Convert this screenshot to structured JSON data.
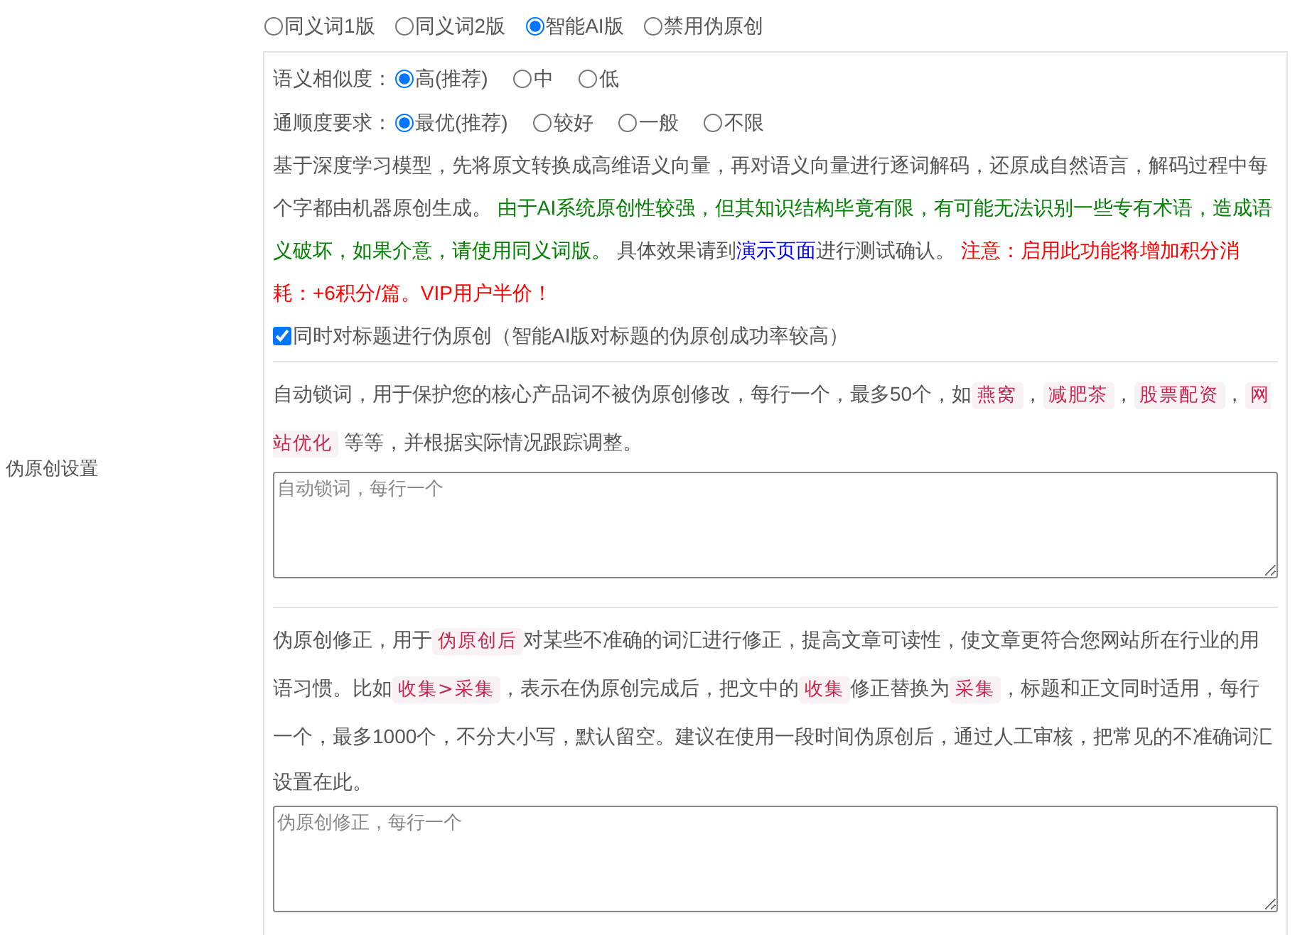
{
  "section_label": "伪原创设置",
  "modes": [
    {
      "label": "同义词1版",
      "selected": false
    },
    {
      "label": "同义词2版",
      "selected": false
    },
    {
      "label": "智能AI版",
      "selected": true
    },
    {
      "label": "禁用伪原创",
      "selected": false
    }
  ],
  "similarity": {
    "label": "语义相似度：",
    "options": [
      {
        "label": "高(推荐)",
        "selected": true
      },
      {
        "label": "中",
        "selected": false
      },
      {
        "label": "低",
        "selected": false
      }
    ]
  },
  "fluency": {
    "label": "通顺度要求：",
    "options": [
      {
        "label": "最优(推荐)",
        "selected": true
      },
      {
        "label": "较好",
        "selected": false
      },
      {
        "label": "一般",
        "selected": false
      },
      {
        "label": "不限",
        "selected": false
      }
    ]
  },
  "ai_description": [
    {
      "kind": "plain",
      "text": "基于深度学习模型，先将原文转换成高维语义向量，再对语义向量进行逐词解码，还原成自然语言，解码过程中每个字都由机器原创生成。 "
    },
    {
      "kind": "green",
      "text": "由于AI系统原创性较强，但其知识结构毕竟有限，有可能无法识别一些专有术语，造成语义破坏，如果介意，请使用同义词版。"
    },
    {
      "kind": "plain",
      "text": " 具体效果请到"
    },
    {
      "kind": "link",
      "text": "演示页面"
    },
    {
      "kind": "plain",
      "text": "进行测试确认。 "
    },
    {
      "kind": "red",
      "text": "注意：启用此功能将增加积分消耗：+6积分/篇。VIP用户半价！"
    }
  ],
  "title_option": {
    "label": "同时对标题进行伪原创（智能AI版对标题的伪原创成功率较高）",
    "checked": true
  },
  "lock_words": {
    "description": [
      {
        "kind": "plain",
        "text": "自动锁词，用于保护您的核心产品词不被伪原创修改，每行一个，最多50个，如"
      },
      {
        "kind": "code",
        "text": "燕窝"
      },
      {
        "kind": "plain",
        "text": "，"
      },
      {
        "kind": "code",
        "text": "减肥茶"
      },
      {
        "kind": "plain",
        "text": "，"
      },
      {
        "kind": "code",
        "text": "股票配资"
      },
      {
        "kind": "plain",
        "text": "，"
      },
      {
        "kind": "code",
        "text": "网站优化"
      },
      {
        "kind": "plain",
        "text": " 等等，并根据实际情况跟踪调整。"
      }
    ],
    "placeholder": "自动锁词，每行一个"
  },
  "corrections": {
    "description": [
      {
        "kind": "plain",
        "text": "伪原创修正，用于"
      },
      {
        "kind": "code",
        "text": "伪原创后"
      },
      {
        "kind": "plain",
        "text": "对某些不准确的词汇进行修正，提高文章可读性，使文章更符合您网站所在行业的用语习惯。比如"
      },
      {
        "kind": "code",
        "text": "收集>采集"
      },
      {
        "kind": "plain",
        "text": "，表示在伪原创完成后，把文中的"
      },
      {
        "kind": "code",
        "text": "收集"
      },
      {
        "kind": "plain",
        "text": "修正替换为"
      },
      {
        "kind": "code",
        "text": "采集"
      },
      {
        "kind": "plain",
        "text": "，标题和正文同时适用，每行一个，最多1000个，不分大小写，默认留空。建议在使用一段时间伪原创后，通过人工审核，把常见的不准确词汇设置在此。"
      }
    ],
    "placeholder": "伪原创修正，每行一个"
  }
}
